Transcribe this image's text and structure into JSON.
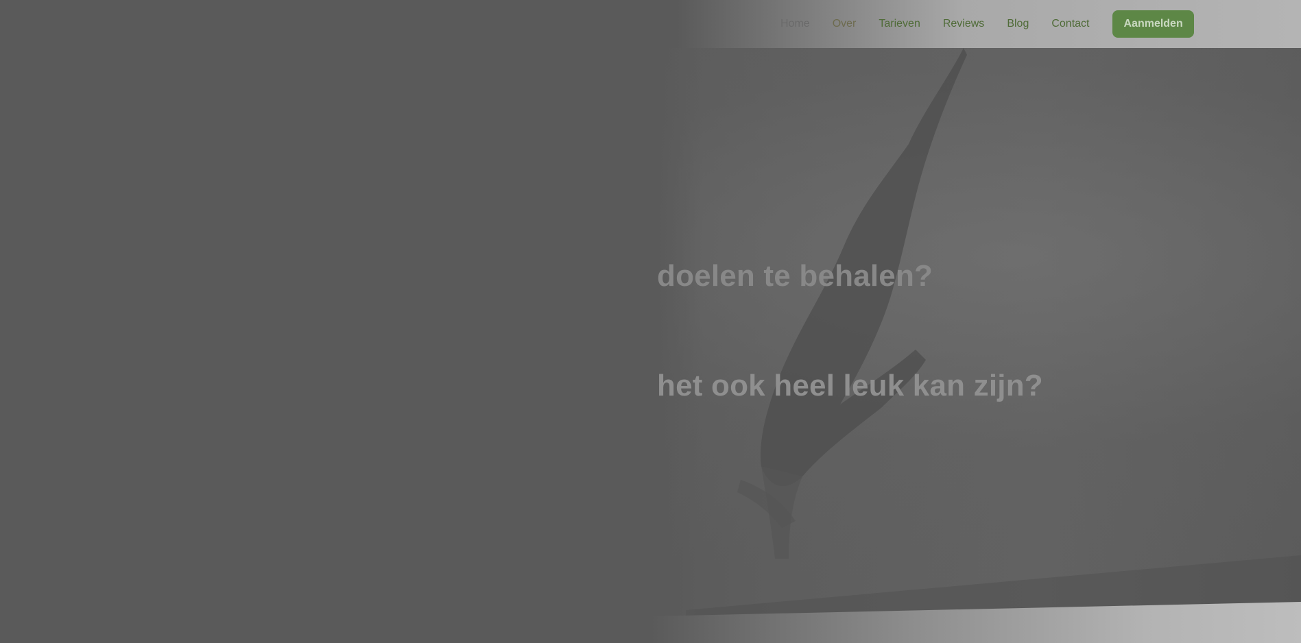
{
  "nav": {
    "items": [
      {
        "label": "Home"
      },
      {
        "label": "Over"
      },
      {
        "label": "Tarieven"
      },
      {
        "label": "Reviews"
      },
      {
        "label": "Blog"
      },
      {
        "label": "Contact"
      }
    ],
    "cta_label": "Aanmelden"
  },
  "hero": {
    "line1": "doelen te behalen?",
    "line2": "het ook heel leuk kan zijn?",
    "image": "yoga-handstand-photo"
  },
  "colors": {
    "overlay": "#5a5a5a",
    "cta_bg": "#5d8746",
    "nav_text": "#4f6b37"
  }
}
